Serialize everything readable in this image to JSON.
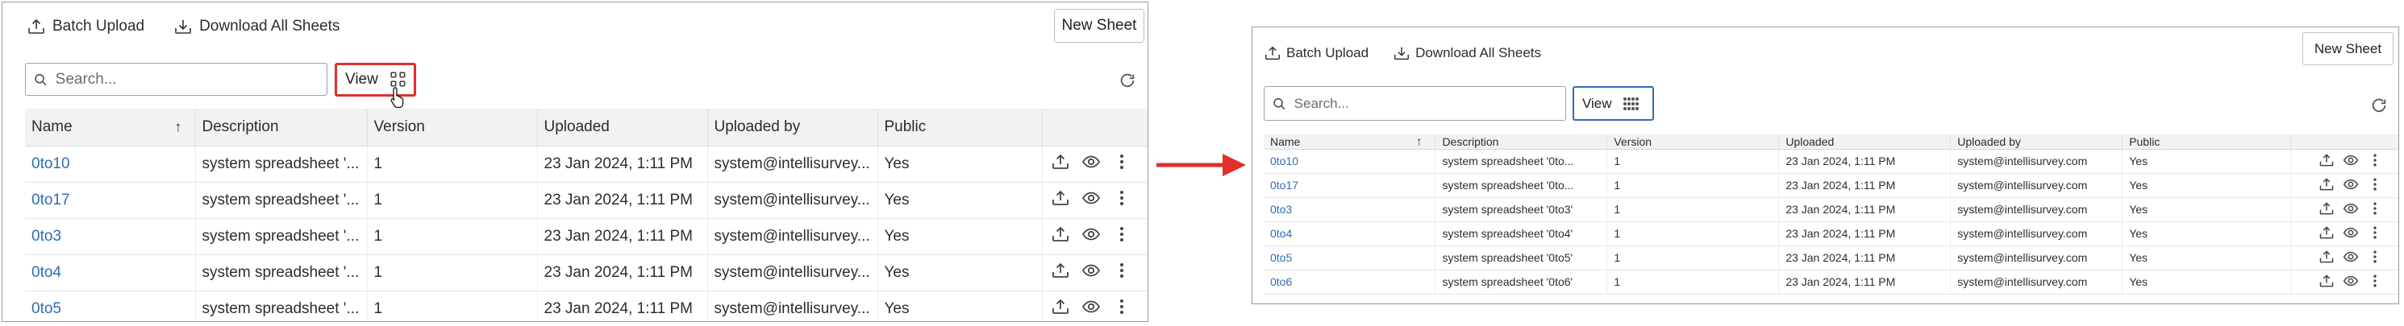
{
  "toolbar": {
    "batch_upload_label": "Batch Upload",
    "download_all_label": "Download All Sheets",
    "new_sheet_label": "New Sheet"
  },
  "search": {
    "placeholder": "Search...",
    "value": ""
  },
  "view_button": {
    "label": "View"
  },
  "table": {
    "columns": [
      "Name",
      "Description",
      "Version",
      "Uploaded",
      "Uploaded by",
      "Public"
    ],
    "sorted_column": "Name",
    "sort_direction": "ascending"
  },
  "before": {
    "rows": [
      {
        "name": "0to10",
        "description": "system spreadsheet '...",
        "version": "1",
        "uploaded": "23 Jan 2024, 1:11 PM",
        "uploaded_by": "system@intellisurvey...",
        "public": "Yes"
      },
      {
        "name": "0to17",
        "description": "system spreadsheet '...",
        "version": "1",
        "uploaded": "23 Jan 2024, 1:11 PM",
        "uploaded_by": "system@intellisurvey...",
        "public": "Yes"
      },
      {
        "name": "0to3",
        "description": "system spreadsheet '...",
        "version": "1",
        "uploaded": "23 Jan 2024, 1:11 PM",
        "uploaded_by": "system@intellisurvey...",
        "public": "Yes"
      },
      {
        "name": "0to4",
        "description": "system spreadsheet '...",
        "version": "1",
        "uploaded": "23 Jan 2024, 1:11 PM",
        "uploaded_by": "system@intellisurvey...",
        "public": "Yes"
      },
      {
        "name": "0to5",
        "description": "system spreadsheet '...",
        "version": "1",
        "uploaded": "23 Jan 2024, 1:11 PM",
        "uploaded_by": "system@intellisurvey...",
        "public": "Yes"
      }
    ]
  },
  "after": {
    "rows": [
      {
        "name": "0to10",
        "description": "system spreadsheet '0to...",
        "version": "1",
        "uploaded": "23 Jan 2024, 1:11 PM",
        "uploaded_by": "system@intellisurvey.com",
        "public": "Yes"
      },
      {
        "name": "0to17",
        "description": "system spreadsheet '0to...",
        "version": "1",
        "uploaded": "23 Jan 2024, 1:11 PM",
        "uploaded_by": "system@intellisurvey.com",
        "public": "Yes"
      },
      {
        "name": "0to3",
        "description": "system spreadsheet '0to3'",
        "version": "1",
        "uploaded": "23 Jan 2024, 1:11 PM",
        "uploaded_by": "system@intellisurvey.com",
        "public": "Yes"
      },
      {
        "name": "0to4",
        "description": "system spreadsheet '0to4'",
        "version": "1",
        "uploaded": "23 Jan 2024, 1:11 PM",
        "uploaded_by": "system@intellisurvey.com",
        "public": "Yes"
      },
      {
        "name": "0to5",
        "description": "system spreadsheet '0to5'",
        "version": "1",
        "uploaded": "23 Jan 2024, 1:11 PM",
        "uploaded_by": "system@intellisurvey.com",
        "public": "Yes"
      },
      {
        "name": "0to6",
        "description": "system spreadsheet '0to6'",
        "version": "1",
        "uploaded": "23 Jan 2024, 1:11 PM",
        "uploaded_by": "system@intellisurvey.com",
        "public": "Yes"
      }
    ]
  },
  "row_actions": [
    "upload-icon",
    "eye-icon",
    "more-vertical-icon"
  ],
  "colors": {
    "link": "#2e6db4",
    "highlight_border": "#e0302b",
    "active_view_border": "#2e6db4",
    "arrow": "#e0302b",
    "header_bg": "#f1f2f4"
  }
}
